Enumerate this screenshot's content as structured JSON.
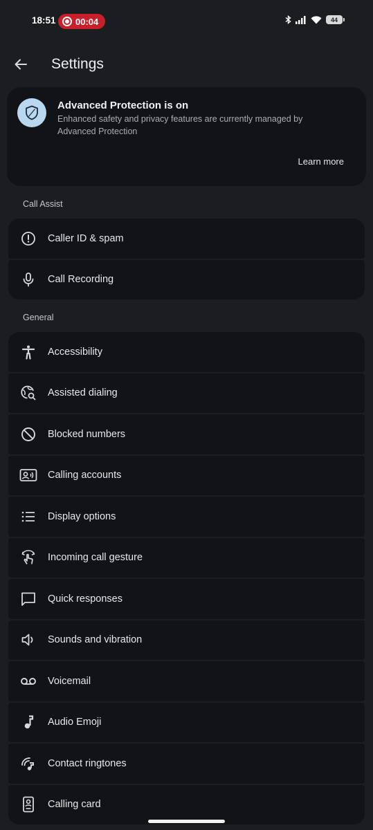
{
  "status_bar": {
    "time": "18:51",
    "recording_time": "00:04",
    "battery": "44"
  },
  "header": {
    "title": "Settings"
  },
  "protection": {
    "title": "Advanced Protection is on",
    "description": "Enhanced safety and privacy features are currently managed by Advanced Protection",
    "learn_more": "Learn more"
  },
  "sections": {
    "call_assist": {
      "title": "Call Assist",
      "items": [
        {
          "label": "Caller ID & spam",
          "icon": "alert-circle-icon"
        },
        {
          "label": "Call Recording",
          "icon": "mic-icon"
        }
      ]
    },
    "general": {
      "title": "General",
      "items": [
        {
          "label": "Accessibility",
          "icon": "accessibility-icon"
        },
        {
          "label": "Assisted dialing",
          "icon": "globe-search-icon"
        },
        {
          "label": "Blocked numbers",
          "icon": "block-icon"
        },
        {
          "label": "Calling accounts",
          "icon": "contact-card-icon"
        },
        {
          "label": "Display options",
          "icon": "list-icon"
        },
        {
          "label": "Incoming call gesture",
          "icon": "gesture-icon"
        },
        {
          "label": "Quick responses",
          "icon": "chat-bubble-icon"
        },
        {
          "label": "Sounds and vibration",
          "icon": "speaker-icon"
        },
        {
          "label": "Voicemail",
          "icon": "voicemail-icon"
        },
        {
          "label": "Audio Emoji",
          "icon": "music-note-icon"
        },
        {
          "label": "Contact ringtones",
          "icon": "ringtone-icon"
        },
        {
          "label": "Calling card",
          "icon": "calling-card-icon"
        }
      ]
    }
  },
  "colors": {
    "background": "#1b1d21",
    "card": "#121316",
    "recording": "#c8202a",
    "shield_badge": "#b9d8ef"
  }
}
